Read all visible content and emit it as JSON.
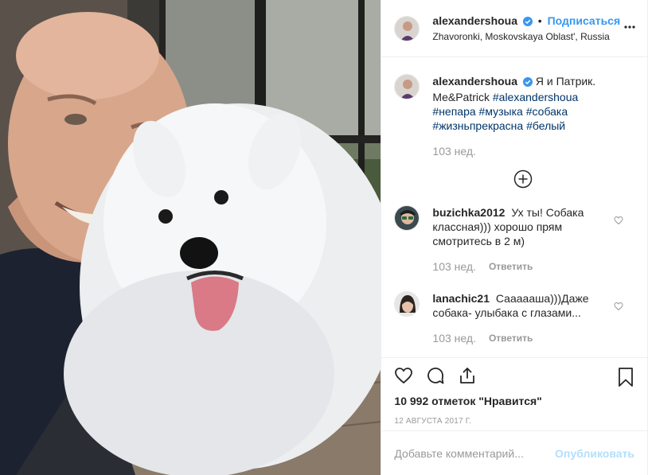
{
  "header": {
    "username": "alexandershoua",
    "separator": "•",
    "follow_label": "Подписаться",
    "location": "Zhavoronki, Moskovskaya Oblast', Russia"
  },
  "caption": {
    "username": "alexandershoua",
    "text": "Я и Патрик. Me&Patrick",
    "hashtags": [
      "#alexandershoua",
      "#непара",
      "#музыка",
      "#собака",
      "#жизньпрекрасна",
      "#белый"
    ],
    "time": "103 нед."
  },
  "comments": [
    {
      "username": "buzichka2012",
      "text": "Ух ты! Собака классная))) хорошо прям смотритесь в 2 м)",
      "time": "103 нед.",
      "reply_label": "Ответить"
    },
    {
      "username": "lanachic21",
      "text": "Саааааша)))Даже собака- улыбака с глазами...",
      "time": "103 нед.",
      "reply_label": "Ответить"
    }
  ],
  "likes_text": "10 992 отметок \"Нравится\"",
  "date_text": "12 августа 2017 г.",
  "add_comment": {
    "placeholder": "Добавьте комментарий...",
    "publish_label": "Опубликовать"
  },
  "icons": {
    "verified": "verified-badge-icon",
    "more": "more-options-icon",
    "load_more": "plus-circle-icon",
    "comment_like": "heart-outline-icon",
    "like": "heart-outline-icon",
    "comment": "speech-bubble-icon",
    "share": "share-icon",
    "save": "bookmark-icon"
  },
  "colors": {
    "accent": "#3897f0",
    "hashtag": "#003569",
    "muted": "#999999",
    "publish_disabled": "#b2dffc"
  }
}
